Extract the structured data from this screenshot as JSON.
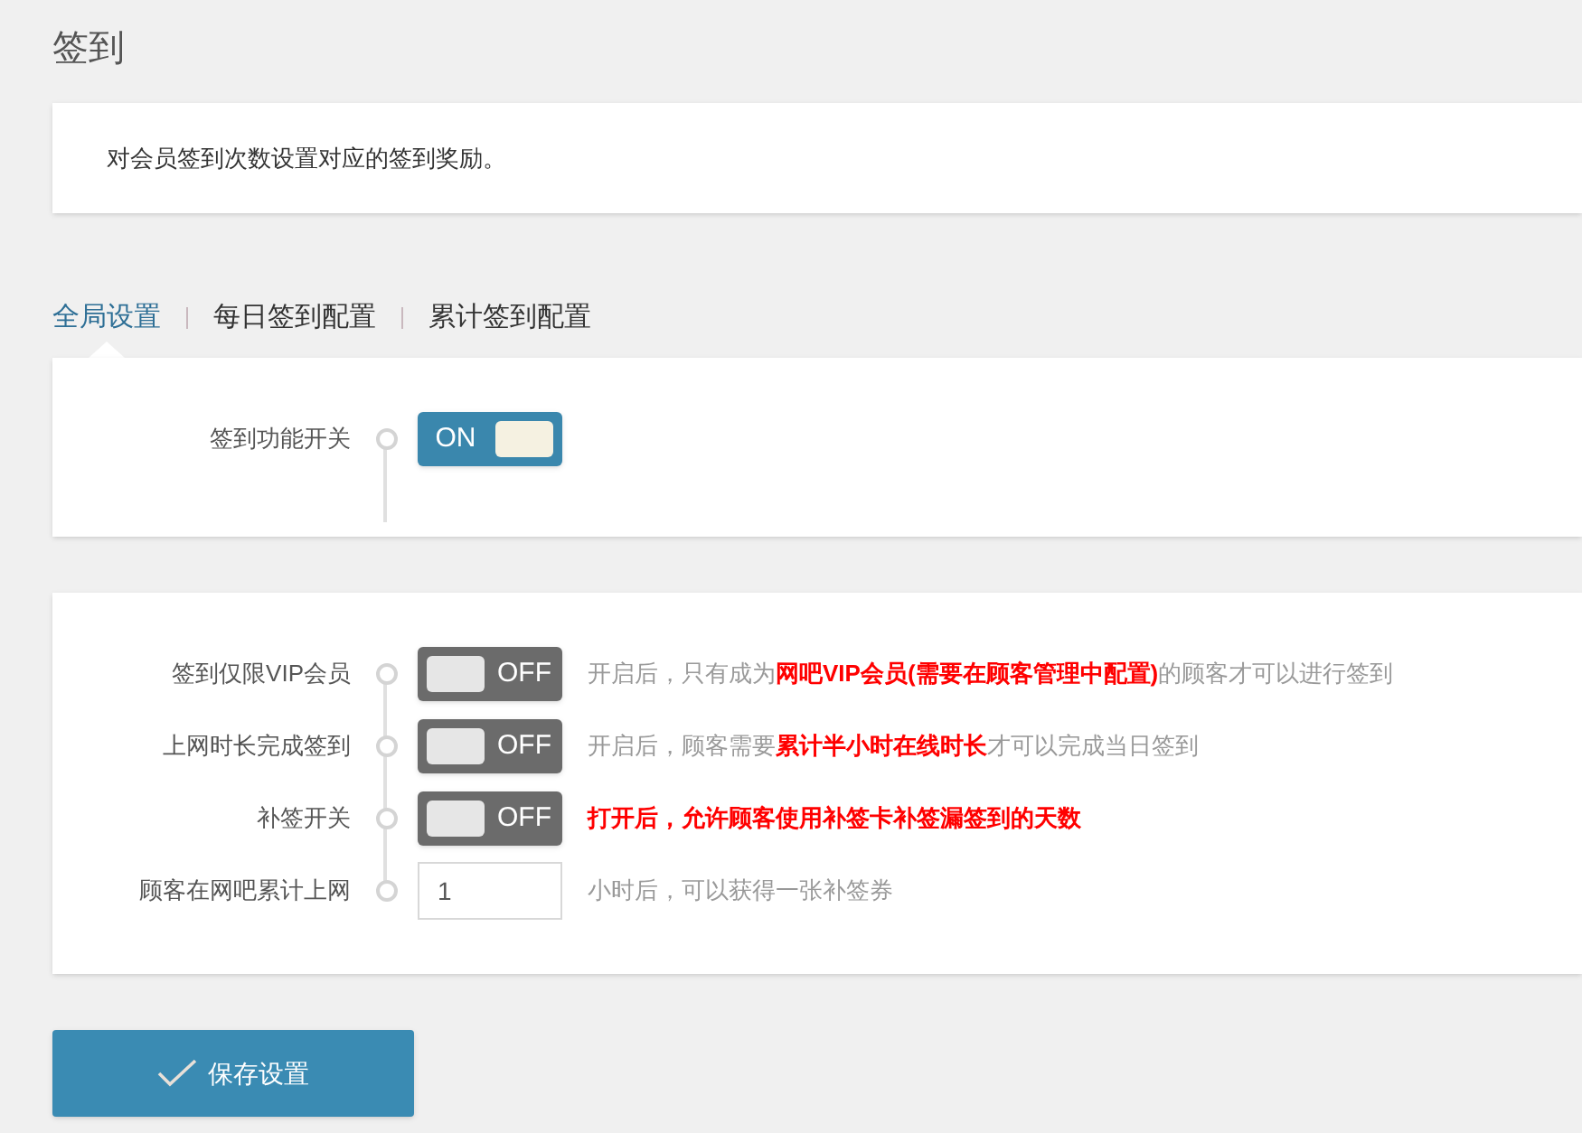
{
  "title": "签到",
  "intro": "对会员签到次数设置对应的签到奖励。",
  "tabs": [
    {
      "label": "全局设置",
      "selected": true
    },
    {
      "label": "每日签到配置",
      "selected": false
    },
    {
      "label": "累计签到配置",
      "selected": false
    }
  ],
  "main_switch": {
    "label": "签到功能开关",
    "on": true,
    "text": "ON"
  },
  "rows": [
    {
      "kind": "switch",
      "label": "签到仅限VIP会员",
      "on": false,
      "text": "OFF",
      "hint": "开启后，只有成为**网吧VIP会员(需要在顾客管理中配置)**的顾客才可以进行签到",
      "emphasis": false
    },
    {
      "kind": "switch",
      "label": "上网时长完成签到",
      "on": false,
      "text": "OFF",
      "hint": "开启后，顾客需要**累计半小时在线时长**才可以完成当日签到",
      "emphasis": false
    },
    {
      "kind": "switch",
      "label": "补签开关",
      "on": false,
      "text": "OFF",
      "hint": "打开后，允许顾客使用补签卡补签漏签到的天数",
      "emphasis": true
    },
    {
      "kind": "input",
      "label": "顾客在网吧累计上网",
      "value": "1",
      "hint": "小时后，可以获得一张补签券",
      "emphasis": false
    }
  ],
  "save_button": "保存设置"
}
